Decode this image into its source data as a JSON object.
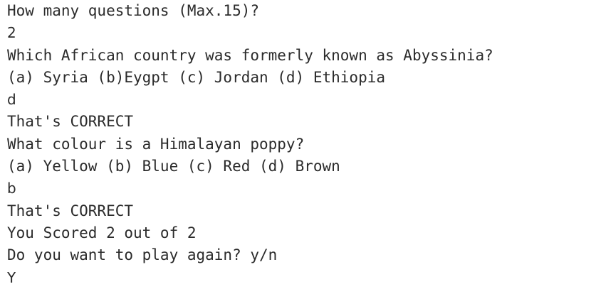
{
  "console": {
    "lines": [
      {
        "kind": "output",
        "text": "How many questions (Max.15)?"
      },
      {
        "kind": "input",
        "text": "2"
      },
      {
        "kind": "output",
        "text": "Which African country was formerly known as Abyssinia?"
      },
      {
        "kind": "output",
        "text": "(a) Syria (b)Eygpt (c) Jordan (d) Ethiopia"
      },
      {
        "kind": "input",
        "text": "d"
      },
      {
        "kind": "output",
        "text": "That's CORRECT"
      },
      {
        "kind": "output",
        "text": "What colour is a Himalayan poppy?"
      },
      {
        "kind": "output",
        "text": "(a) Yellow (b) Blue (c) Red (d) Brown"
      },
      {
        "kind": "input",
        "text": "b"
      },
      {
        "kind": "output",
        "text": "That's CORRECT"
      },
      {
        "kind": "output",
        "text": "You Scored 2 out of 2"
      },
      {
        "kind": "output",
        "text": "Do you want to play again? y/n"
      },
      {
        "kind": "input",
        "text": "Y"
      }
    ]
  }
}
